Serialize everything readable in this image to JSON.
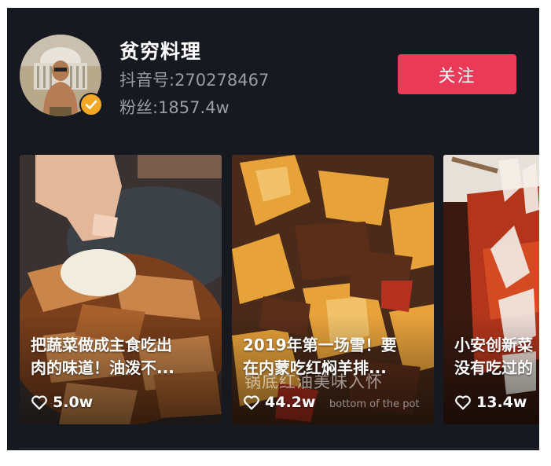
{
  "profile": {
    "name": "贫穷料理",
    "douyin_id": "抖音号:270278467",
    "fans": "粉丝:1857.4w",
    "follow_label": "关注",
    "verified_icon": "check-icon"
  },
  "videos": [
    {
      "title_line1": "把蔬菜做成主食吃出",
      "title_line2": "肉的味道！油泼不...",
      "likes": "5.0w"
    },
    {
      "title_line1": "2019年第一场雪！要",
      "title_line2": "在内蒙吃红焖羊排...",
      "likes": "44.2w",
      "overlay_text_cn": "锅底红油美味入怀",
      "overlay_text_en": "bottom of the pot"
    },
    {
      "title_line1": "小安创新菜",
      "title_line2": "没有吃过的",
      "likes": "13.4w"
    }
  ],
  "colors": {
    "background": "#171921",
    "follow_button": "#ea3a58",
    "verified_badge": "#f5a623",
    "secondary_text": "#9a9ba4"
  }
}
